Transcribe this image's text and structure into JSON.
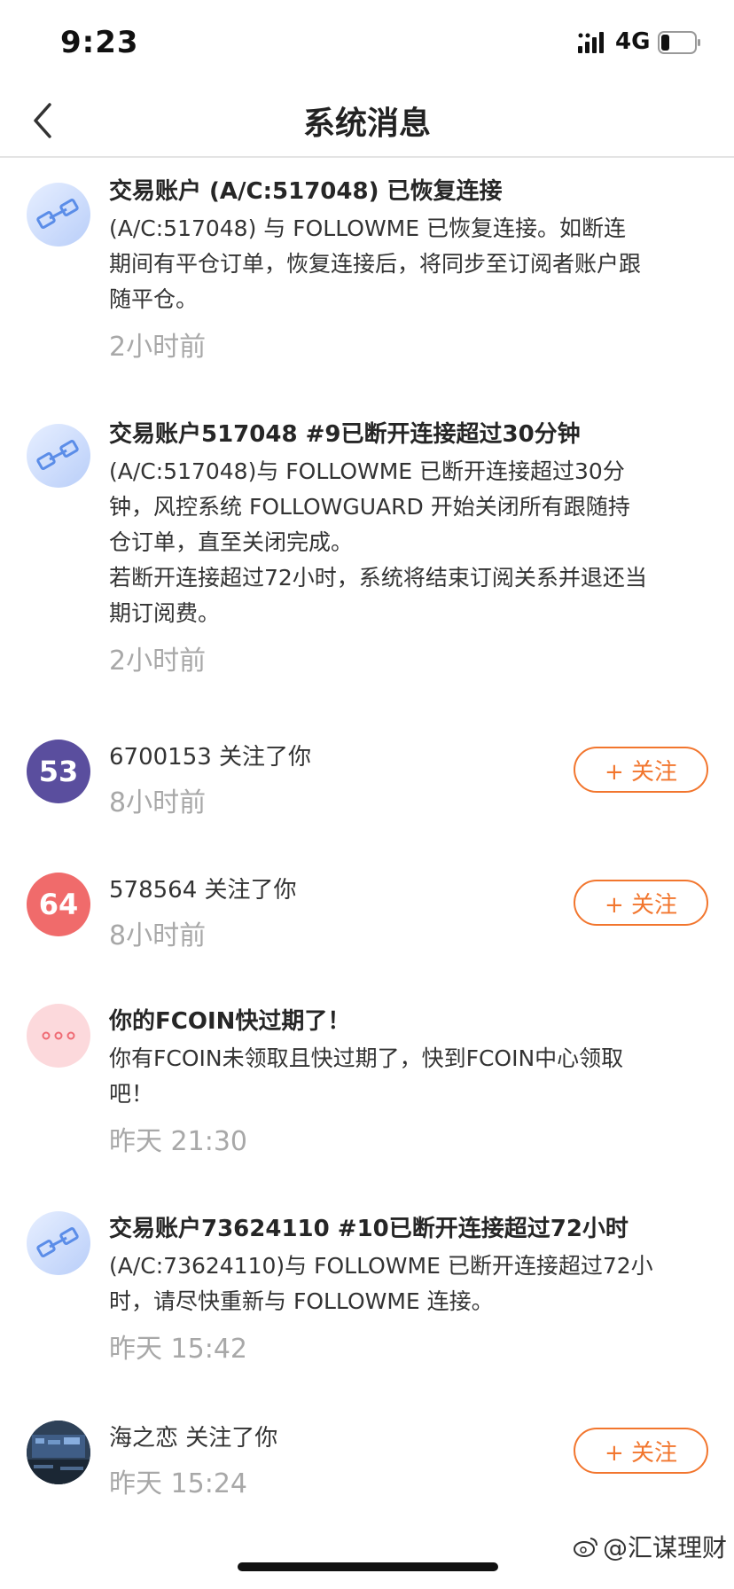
{
  "status_bar": {
    "time": "9:23",
    "network": "4G"
  },
  "header": {
    "title": "系统消息"
  },
  "messages": [
    {
      "title": "交易账户 (A/C:517048) 已恢复连接",
      "text": "(A/C:517048) 与  FOLLOWME  已恢复连接。如断连\n期间有平仓订单，恢复连接后，将同步至订阅者账户跟\n随平仓。",
      "time": "2小时前"
    },
    {
      "title": "交易账户517048 #9已断开连接超过30分钟",
      "text": "(A/C:517048)与 FOLLOWME 已断开连接超过30分\n钟，风控系统 FOLLOWGUARD 开始关闭所有跟随持\n仓订单，直至关闭完成。\n若断开连接超过72小时，系统将结束订阅关系并退还当\n期订阅费。",
      "time": "2小时前"
    },
    {
      "avatar_text": "53",
      "avatar_color": "#5a4e9e",
      "user": "6700153",
      "action": " 关注了你",
      "time": "8小时前",
      "button": "+ 关注"
    },
    {
      "avatar_text": "64",
      "avatar_color": "#f06b6b",
      "user": "578564",
      "action": " 关注了你",
      "time": "8小时前",
      "button": "+ 关注"
    },
    {
      "title": "你的FCOIN快过期了！",
      "text": "你有FCOIN未领取且快过期了，快到FCOIN中心领取\n吧！",
      "time": "昨天 21:30"
    },
    {
      "title": "交易账户73624110 #10已断开连接超过72小时",
      "text": "(A/C:73624110)与 FOLLOWME 已断开连接超过72小\n时，请尽快重新与 FOLLOWME 连接。",
      "time": "昨天 15:42"
    },
    {
      "user": "海之恋",
      "action": " 关注了你",
      "time": "昨天 15:24",
      "button": "+ 关注"
    }
  ],
  "watermark": "@汇谋理财",
  "colors": {
    "accent": "#f2762e",
    "time_gray": "#a8a8a8"
  }
}
